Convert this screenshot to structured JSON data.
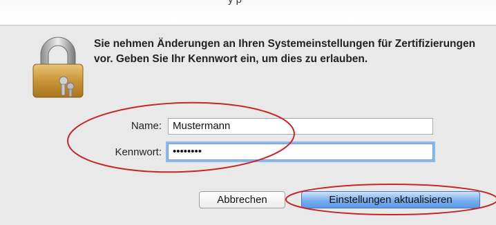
{
  "window": {
    "title_fragment": "y    p"
  },
  "dialog": {
    "message": "Sie nehmen Änderungen an Ihren Systemeinstellungen für Zertifizierungen vor. Geben Sie Ihr Kennwort ein, um dies zu erlauben.",
    "icon": "lock-icon"
  },
  "form": {
    "name_label": "Name:",
    "name_value": "Mustermann",
    "password_label": "Kennwort:",
    "password_value": "••••••••"
  },
  "buttons": {
    "cancel_label": "Abbrechen",
    "update_label": "Einstellungen aktualisieren"
  },
  "colors": {
    "annotation": "#c4262a",
    "default_button": "#6aa4ea",
    "focus_ring": "#8eb7ee"
  }
}
